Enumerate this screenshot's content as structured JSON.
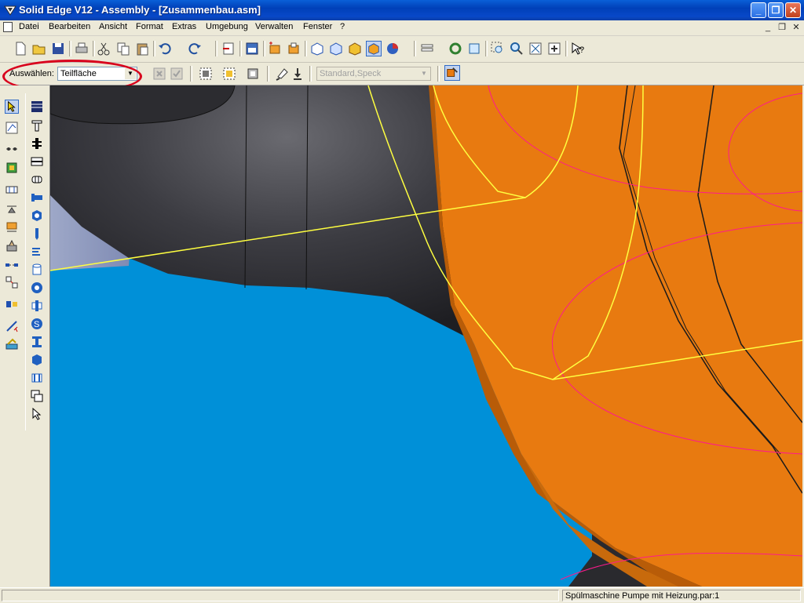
{
  "window": {
    "title": "Solid Edge V12 - Assembly - [Zusammenbau.asm]",
    "controls": {
      "minimize": "_",
      "maximize": "❐",
      "close": "✕"
    }
  },
  "menu": {
    "items": [
      "Datei",
      "Bearbeiten",
      "Ansicht",
      "Format",
      "Extras",
      "Umgebung",
      "Verwalten",
      "Fenster",
      "?"
    ],
    "mdi_controls": [
      "_",
      "❐",
      "✕"
    ]
  },
  "toolbar_top": {
    "icons": [
      "new-icon",
      "open-icon",
      "save-icon",
      "print-icon",
      "cut-icon",
      "copy-icon",
      "paste-icon",
      "undo-icon",
      "redo-icon",
      "insert-icon",
      "sheet-icon",
      "part-icon",
      "assembly-icon",
      "view-top-icon",
      "view-iso-icon",
      "shade-icon",
      "shade-edges-icon",
      "color-icon",
      "layer-icon",
      "refresh-icon",
      "fit-icon",
      "zoom-area-icon",
      "zoom-icon",
      "fit-all-icon",
      "pan-icon",
      "help-icon"
    ]
  },
  "ribbon": {
    "label": "Auswählen:",
    "select_value": "Teilfläche",
    "style_value": "Standard,Speck"
  },
  "statusbar": {
    "text": "Spülmaschine Pumpe mit Heizung.par:1"
  },
  "colors": {
    "viewport_blue": "#0090d8",
    "part_orange": "#e87a10",
    "part_gray": "#3a3a3e",
    "highlight_yellow": "#ffff40",
    "annotation_red": "#d8001c"
  }
}
